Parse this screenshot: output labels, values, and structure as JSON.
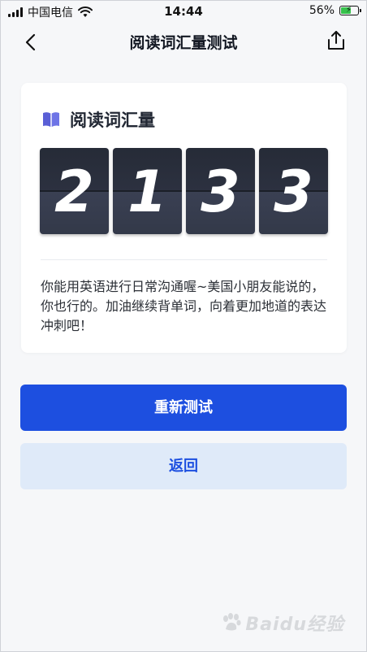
{
  "status_bar": {
    "carrier": "中国电信",
    "time": "14:44",
    "battery_percent": "56%",
    "battery_level": 0.56
  },
  "nav": {
    "title": "阅读词汇量测试",
    "back_icon": "chevron-left-icon",
    "share_icon": "share-icon"
  },
  "card": {
    "icon": "book-icon",
    "title": "阅读词汇量",
    "digits": [
      "2",
      "1",
      "3",
      "3"
    ],
    "description": "你能用英语进行日常沟通喔~美国小朋友能说的，你也行的。加油继续背单词，向着更加地道的表达冲刺吧！"
  },
  "buttons": {
    "retest": "重新测试",
    "back": "返回"
  },
  "watermark": {
    "text": "Baidu经验"
  },
  "colors": {
    "primary": "#1d4fe0",
    "secondary_bg": "#dfeaf9",
    "flip_card": "#2c3140",
    "book_icon": "#5a5fd6"
  }
}
